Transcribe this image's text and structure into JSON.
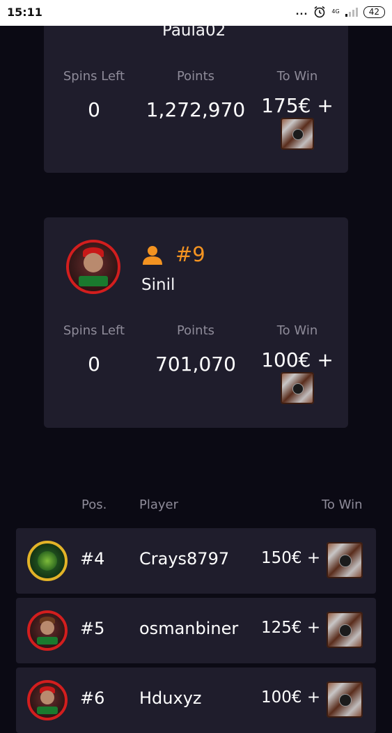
{
  "status_bar": {
    "time": "15:11",
    "dots": "...",
    "network": "4G",
    "battery": "42"
  },
  "top_card": {
    "name": "Paula02",
    "spins_label": "Spins Left",
    "spins_value": "0",
    "points_label": "Points",
    "points_value": "1,272,970",
    "towin_label": "To Win",
    "towin_value": "175€ +"
  },
  "player_card": {
    "rank": "#9",
    "name": "Sinil",
    "spins_label": "Spins Left",
    "spins_value": "0",
    "points_label": "Points",
    "points_value": "701,070",
    "towin_label": "To Win",
    "towin_value": "100€ +"
  },
  "leaderboard": {
    "headers": {
      "pos": "Pos.",
      "player": "Player",
      "towin": "To Win"
    },
    "rows": [
      {
        "pos": "#4",
        "player": "Crays8797",
        "towin": "150€ +"
      },
      {
        "pos": "#5",
        "player": "osmanbiner",
        "towin": "125€ +"
      },
      {
        "pos": "#6",
        "player": "Hduxyz",
        "towin": "100€ +"
      }
    ]
  },
  "colors": {
    "background": "#0b0a14",
    "card": "#1f1d2c",
    "accent": "#f39321",
    "muted": "#8e8b99"
  }
}
